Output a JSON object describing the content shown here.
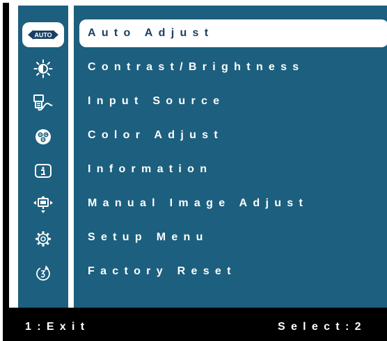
{
  "colors": {
    "panel_background": "#1d5f7e",
    "selected_background": "#ffffff",
    "selected_text": "#1a3f63",
    "text": "#ffffff",
    "frame": "#000000"
  },
  "sidebar": {
    "icons": [
      {
        "name": "auto-icon",
        "badge": "AUTO",
        "selected": true
      },
      {
        "name": "brightness-icon",
        "selected": false
      },
      {
        "name": "input-source-icon",
        "selected": false
      },
      {
        "name": "color-adjust-icon",
        "badge": "RGB",
        "selected": false
      },
      {
        "name": "information-icon",
        "selected": false
      },
      {
        "name": "manual-image-adjust-icon",
        "selected": false
      },
      {
        "name": "setup-gear-icon",
        "selected": false
      },
      {
        "name": "factory-reset-icon",
        "selected": false
      }
    ]
  },
  "menu": {
    "items": [
      {
        "label": "Auto Adjust",
        "selected": true
      },
      {
        "label": "Contrast/Brightness",
        "selected": false
      },
      {
        "label": "Input Source",
        "selected": false
      },
      {
        "label": "Color Adjust",
        "selected": false
      },
      {
        "label": "Information",
        "selected": false
      },
      {
        "label": "Manual Image Adjust",
        "selected": false
      },
      {
        "label": "Setup Menu",
        "selected": false
      },
      {
        "label": "Factory Reset",
        "selected": false
      }
    ]
  },
  "footer": {
    "exit_label": "1:Exit",
    "select_label": "Select:2"
  }
}
